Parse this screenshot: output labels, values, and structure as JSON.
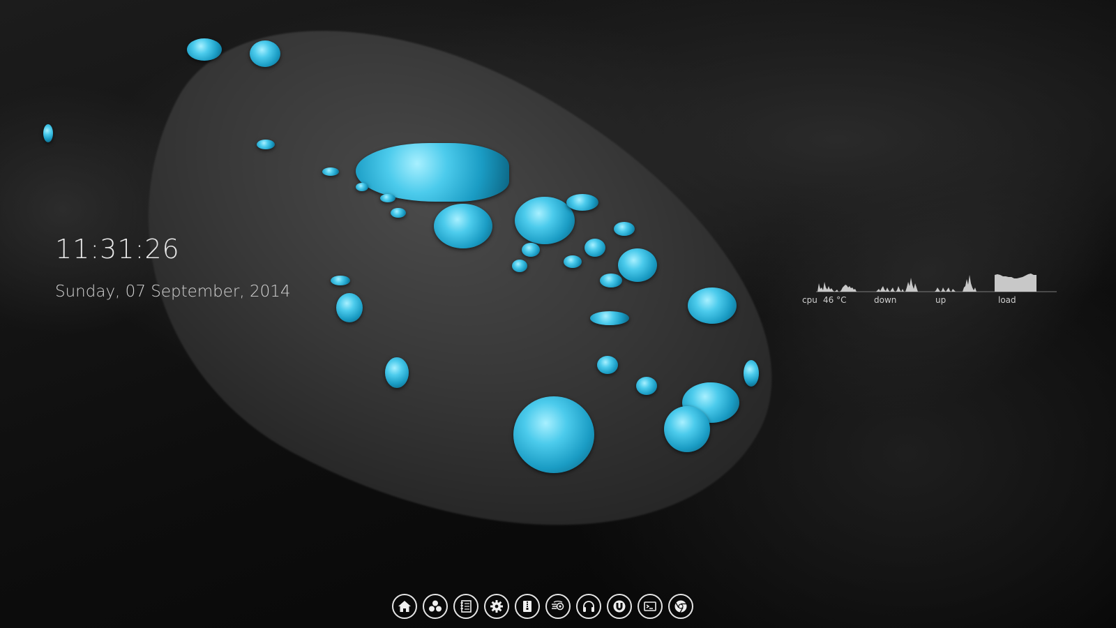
{
  "clock": {
    "time": "11:31:26",
    "date": "Sunday, 07 September, 2014"
  },
  "system_monitor": {
    "cpu_label": "cpu",
    "cpu_temp_label": "46 °C",
    "down_label": "down",
    "up_label": "up",
    "load_label": "load",
    "graph_color": "#c8c8c8"
  },
  "dock": {
    "items": [
      {
        "name": "home",
        "icon": "home-icon"
      },
      {
        "name": "apps",
        "icon": "apps-cluster-icon"
      },
      {
        "name": "notes",
        "icon": "notes-icon"
      },
      {
        "name": "settings",
        "icon": "gear-icon"
      },
      {
        "name": "archive",
        "icon": "archive-icon"
      },
      {
        "name": "network",
        "icon": "network-icon"
      },
      {
        "name": "music",
        "icon": "headphones-icon"
      },
      {
        "name": "torrent",
        "icon": "utorrent-icon"
      },
      {
        "name": "terminal",
        "icon": "terminal-icon"
      },
      {
        "name": "chrome",
        "icon": "chrome-icon"
      }
    ],
    "border_color": "#e6e6e6"
  },
  "wallpaper": {
    "accent": "#3cc3e8",
    "base": "#1a1a1a"
  }
}
